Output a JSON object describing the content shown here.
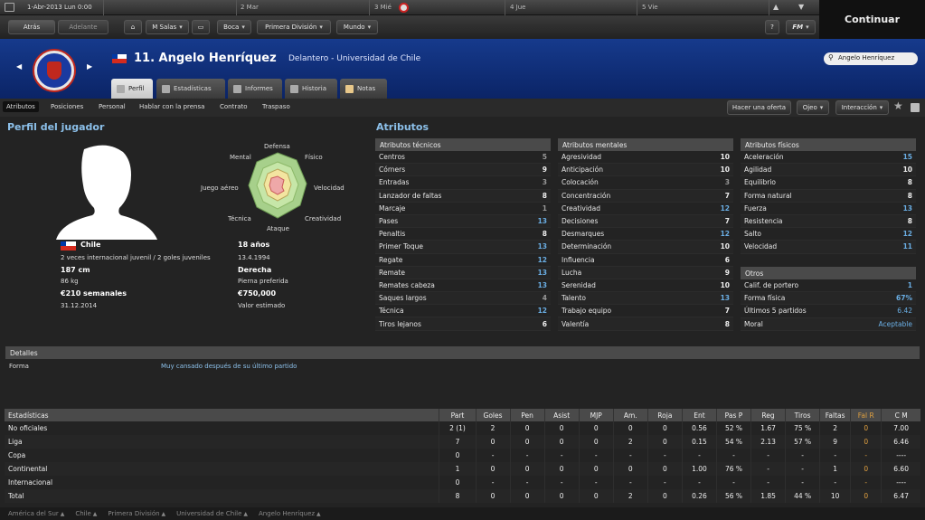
{
  "topbar": {
    "date": "1-Abr-2013 Lun 0:00",
    "days": [
      "2 Mar",
      "3 Mié",
      "4 Jue",
      "5 Vie"
    ],
    "continue": "Continuar"
  },
  "nav": {
    "back": "Atrás",
    "forward": "Adelante",
    "manager": "M Salas",
    "club": "Boca",
    "league": "Primera División",
    "world": "Mundo",
    "help": "?",
    "fm": "FM"
  },
  "player": {
    "name": "11. Angelo Henríquez",
    "position": "Delantero - Universidad de Chile",
    "search": "Angelo Henríquez"
  },
  "tabs": [
    "Perfil",
    "Estadísticas",
    "Informes",
    "Historia",
    "Notas"
  ],
  "subtabs": [
    "Atributos",
    "Posiciones",
    "Personal",
    "Hablar con la prensa",
    "Contrato",
    "Traspaso"
  ],
  "actions": {
    "offer": "Hacer una oferta",
    "scout": "Ojeo",
    "interaction": "Interacción"
  },
  "profile": {
    "title": "Perfil del jugador",
    "nation": "Chile",
    "caps": "2 veces internacional juvenil / 2 goles juveniles",
    "height": "187 cm",
    "weight": "86 kg",
    "wage": "€210 semanales",
    "contract_end": "31.12.2014",
    "age": "18 años",
    "dob": "13.4.1994",
    "foot": "Derecha",
    "foot_label": "Pierna preferida",
    "value": "€750,000",
    "value_label": "Valor estimado"
  },
  "radar": {
    "labels": [
      "Defensa",
      "Físico",
      "Velocidad",
      "Creatividad",
      "Ataque",
      "Técnica",
      "Juego aéreo",
      "Mental"
    ]
  },
  "attributes_title": "Atributos",
  "technical": {
    "title": "Atributos técnicos",
    "rows": [
      [
        "Centros",
        "5"
      ],
      [
        "Córners",
        "9"
      ],
      [
        "Entradas",
        "3"
      ],
      [
        "Lanzador de faltas",
        "8"
      ],
      [
        "Marcaje",
        "1"
      ],
      [
        "Pases",
        "13"
      ],
      [
        "Penaltis",
        "8"
      ],
      [
        "Primer Toque",
        "13"
      ],
      [
        "Regate",
        "12"
      ],
      [
        "Remate",
        "13"
      ],
      [
        "Remates cabeza",
        "13"
      ],
      [
        "Saques largos",
        "4"
      ],
      [
        "Técnica",
        "12"
      ],
      [
        "Tiros lejanos",
        "6"
      ]
    ]
  },
  "mental": {
    "title": "Atributos mentales",
    "rows": [
      [
        "Agresividad",
        "10"
      ],
      [
        "Anticipación",
        "10"
      ],
      [
        "Colocación",
        "3"
      ],
      [
        "Concentración",
        "7"
      ],
      [
        "Creatividad",
        "12"
      ],
      [
        "Decisiones",
        "7"
      ],
      [
        "Desmarques",
        "12"
      ],
      [
        "Determinación",
        "10"
      ],
      [
        "Influencia",
        "6"
      ],
      [
        "Lucha",
        "9"
      ],
      [
        "Serenidad",
        "10"
      ],
      [
        "Talento",
        "13"
      ],
      [
        "Trabajo equipo",
        "7"
      ],
      [
        "Valentía",
        "8"
      ]
    ]
  },
  "physical": {
    "title": "Atributos físicos",
    "rows": [
      [
        "Aceleración",
        "15"
      ],
      [
        "Agilidad",
        "10"
      ],
      [
        "Equilibrio",
        "8"
      ],
      [
        "Forma natural",
        "8"
      ],
      [
        "Fuerza",
        "13"
      ],
      [
        "Resistencia",
        "8"
      ],
      [
        "Salto",
        "12"
      ],
      [
        "Velocidad",
        "11"
      ]
    ]
  },
  "other": {
    "title": "Otros",
    "rows": [
      [
        "Calif. de portero",
        "1"
      ],
      [
        "Forma física",
        "67%"
      ],
      [
        "Últimos 5 partidos",
        "6.42"
      ],
      [
        "Moral",
        "Aceptable"
      ]
    ]
  },
  "details": {
    "title": "Detalles",
    "form_label": "Forma",
    "form_value": "Muy cansado después de su último partido"
  },
  "stats": {
    "headers": [
      "Estadísticas",
      "Part",
      "Goles",
      "Pen",
      "Asist",
      "MJP",
      "Am.",
      "Roja",
      "Ent",
      "Pas P",
      "Reg",
      "Tiros",
      "Faltas",
      "Fal R",
      "C M"
    ],
    "rows": [
      [
        "No oficiales",
        "2 (1)",
        "2",
        "0",
        "0",
        "0",
        "0",
        "0",
        "0.56",
        "52 %",
        "1.67",
        "75 %",
        "2",
        "0",
        "7.00"
      ],
      [
        "Liga",
        "7",
        "0",
        "0",
        "0",
        "0",
        "2",
        "0",
        "0.15",
        "54 %",
        "2.13",
        "57 %",
        "9",
        "0",
        "6.46"
      ],
      [
        "Copa",
        "0",
        "-",
        "-",
        "-",
        "-",
        "-",
        "-",
        "-",
        "-",
        "-",
        "-",
        "-",
        "-",
        "----"
      ],
      [
        "Continental",
        "1",
        "0",
        "0",
        "0",
        "0",
        "0",
        "0",
        "1.00",
        "76 %",
        "-",
        "-",
        "1",
        "0",
        "6.60"
      ],
      [
        "Internacional",
        "0",
        "-",
        "-",
        "-",
        "-",
        "-",
        "-",
        "-",
        "-",
        "-",
        "-",
        "-",
        "-",
        "----"
      ],
      [
        "Total",
        "8",
        "0",
        "0",
        "0",
        "0",
        "2",
        "0",
        "0.26",
        "56 %",
        "1.85",
        "44 %",
        "10",
        "0",
        "6.47"
      ]
    ]
  },
  "breadcrumb": [
    "América del Sur",
    "Chile",
    "Primera División",
    "Universidad de Chile",
    "Angelo Henríquez"
  ],
  "colors": {
    "header": "#163a8c",
    "accent": "#8cc0ea",
    "value_high": "#6aaee4"
  }
}
